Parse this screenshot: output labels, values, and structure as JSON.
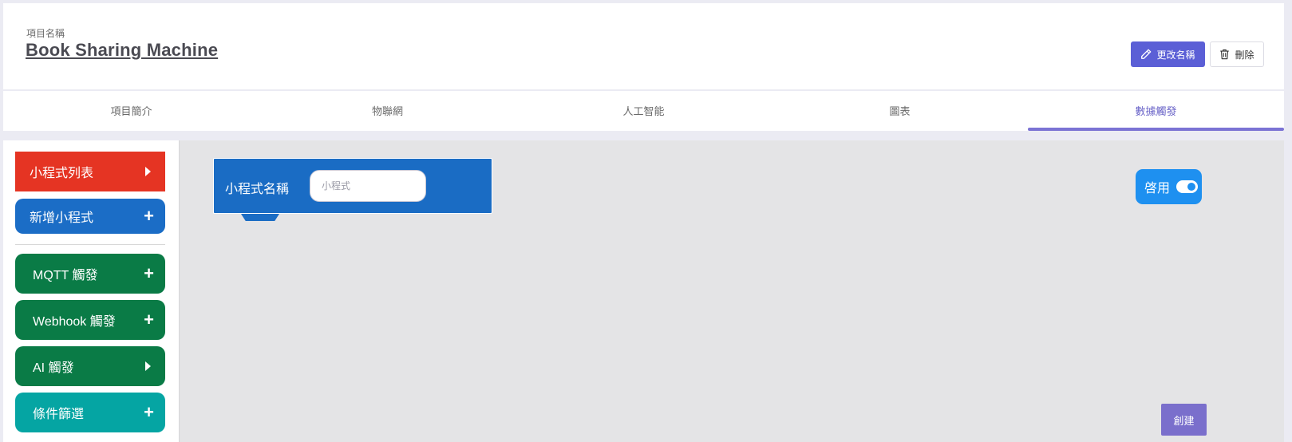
{
  "header": {
    "project_label": "項目名稱",
    "project_name": "Book Sharing Machine",
    "rename_label": "更改名稱",
    "delete_label": "刪除"
  },
  "tabs": [
    {
      "label": "項目簡介",
      "active": false
    },
    {
      "label": "物聯網",
      "active": false
    },
    {
      "label": "人工智能",
      "active": false
    },
    {
      "label": "圖表",
      "active": false
    },
    {
      "label": "數據觸發",
      "active": true
    }
  ],
  "sidebar": {
    "items": [
      {
        "label": "小程式列表",
        "icon": "triangle-right-icon"
      },
      {
        "label": "新增小程式",
        "icon": "plus-icon"
      },
      {
        "label": "MQTT 觸發",
        "icon": "plus-icon"
      },
      {
        "label": "Webhook 觸發",
        "icon": "plus-icon"
      },
      {
        "label": "AI 觸發",
        "icon": "triangle-right-icon"
      },
      {
        "label": "條件篩選",
        "icon": "plus-icon"
      }
    ]
  },
  "block": {
    "name_label": "小程式名稱",
    "name_placeholder": "小程式"
  },
  "enable": {
    "label": "啓用",
    "on": true
  },
  "create_label": "創建",
  "colors": {
    "accent": "#5b5fd6",
    "tab_active": "#6a64c8",
    "red": "#e53423",
    "blue": "#1b6dc6",
    "green": "#0a7b46",
    "teal": "#05a5a3",
    "toggle": "#1e90f0",
    "create": "#7a6fcc"
  }
}
